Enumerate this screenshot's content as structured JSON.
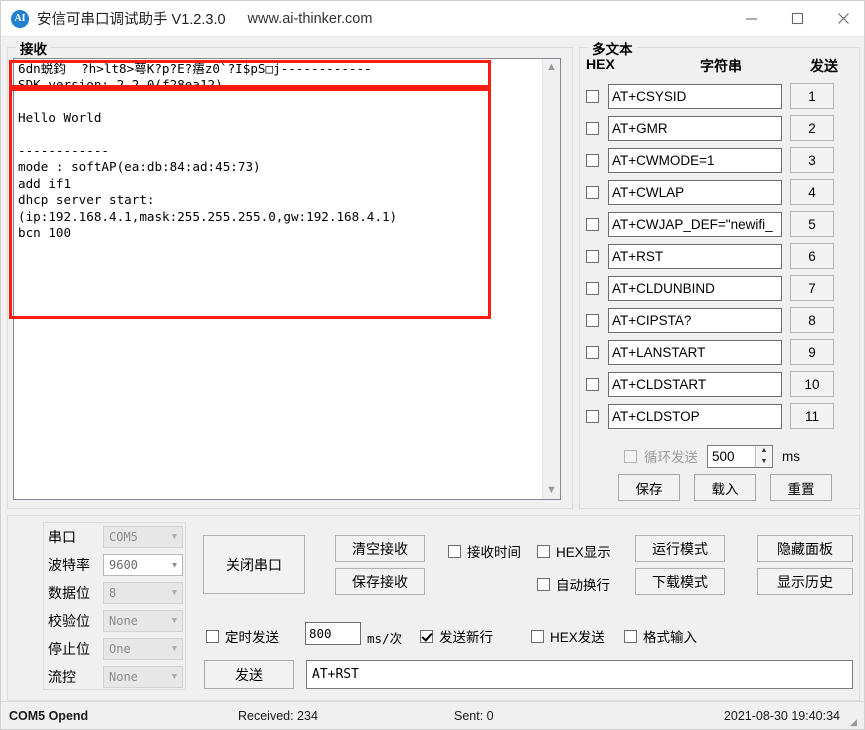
{
  "window": {
    "icon": "app-logo-icon",
    "title": "安信可串口调试助手 V1.2.3.0",
    "url": "www.ai-thinker.com",
    "minimize": "minimize-icon",
    "maximize": "maximize-icon",
    "close": "close-icon"
  },
  "receive": {
    "group_label": "接收",
    "highlighted_line": "6dn蜕鈞  ?h>lt8>萼K?p?E?痦z0`?I$pS□j------------",
    "lines": [
      "SDK version: 2.2.0(f28ea12)",
      "",
      "Hello World",
      "",
      "------------",
      "mode : softAP(ea:db:84:ad:45:73)",
      "add if1",
      "dhcp server start:",
      "(ip:192.168.4.1,mask:255.255.255.0,gw:192.168.4.1)",
      "bcn 100"
    ],
    "scroll_up": "scroll-up-icon",
    "scroll_down": "scroll-down-icon"
  },
  "multitext": {
    "group_label": "多文本",
    "col_hex": "HEX",
    "col_string": "字符串",
    "col_send": "发送",
    "rows": [
      {
        "hex_checked": false,
        "command": "AT+CSYSID",
        "index": "1"
      },
      {
        "hex_checked": false,
        "command": "AT+GMR",
        "index": "2"
      },
      {
        "hex_checked": false,
        "command": "AT+CWMODE=1",
        "index": "3"
      },
      {
        "hex_checked": false,
        "command": "AT+CWLAP",
        "index": "4"
      },
      {
        "hex_checked": false,
        "command": "AT+CWJAP_DEF=\"newifi_",
        "index": "5"
      },
      {
        "hex_checked": false,
        "command": "AT+RST",
        "index": "6"
      },
      {
        "hex_checked": false,
        "command": "AT+CLDUNBIND",
        "index": "7"
      },
      {
        "hex_checked": false,
        "command": "AT+CIPSTA?",
        "index": "8"
      },
      {
        "hex_checked": false,
        "command": "AT+LANSTART",
        "index": "9"
      },
      {
        "hex_checked": false,
        "command": "AT+CLDSTART",
        "index": "10"
      },
      {
        "hex_checked": false,
        "command": "AT+CLDSTOP",
        "index": "11"
      }
    ],
    "loop_label": "循环发送",
    "loop_checked": false,
    "loop_interval": "500",
    "loop_unit": "ms",
    "save_label": "保存",
    "load_label": "载入",
    "reset_label": "重置"
  },
  "serial": {
    "fields": [
      {
        "label": "串口",
        "value": "COM5",
        "enabled": false
      },
      {
        "label": "波特率",
        "value": "9600",
        "enabled": true
      },
      {
        "label": "数据位",
        "value": "8",
        "enabled": false
      },
      {
        "label": "校验位",
        "value": "None",
        "enabled": false
      },
      {
        "label": "停止位",
        "value": "One",
        "enabled": false
      },
      {
        "label": "流控",
        "value": "None",
        "enabled": false
      }
    ]
  },
  "controls": {
    "close_port": "关闭串口",
    "clear_recv": "清空接收",
    "save_recv": "保存接收",
    "recv_time": "接收时间",
    "recv_time_checked": false,
    "hex_show": "HEX显示",
    "hex_show_checked": false,
    "auto_wrap": "自动换行",
    "auto_wrap_checked": false,
    "run_mode": "运行模式",
    "download_mode": "下载模式",
    "hide_panel": "隐藏面板",
    "show_history": "显示历史",
    "timed_send": "定时发送",
    "timed_send_checked": false,
    "timed_interval": "800",
    "timed_unit": "ms/次",
    "send_newline": "发送新行",
    "send_newline_checked": true,
    "hex_send": "HEX发送",
    "hex_send_checked": false,
    "format_input": "格式输入",
    "format_input_checked": false,
    "send_button": "发送",
    "send_value": "AT+RST"
  },
  "status": {
    "port": "COM5 Opend",
    "received": "Received: 234",
    "sent": "Sent: 0",
    "datetime": "2021-08-30 19:40:34"
  },
  "colors": {
    "annotation": "#fc1b11",
    "accent": "#1f7fd0",
    "panel": "#f0f0f0"
  }
}
